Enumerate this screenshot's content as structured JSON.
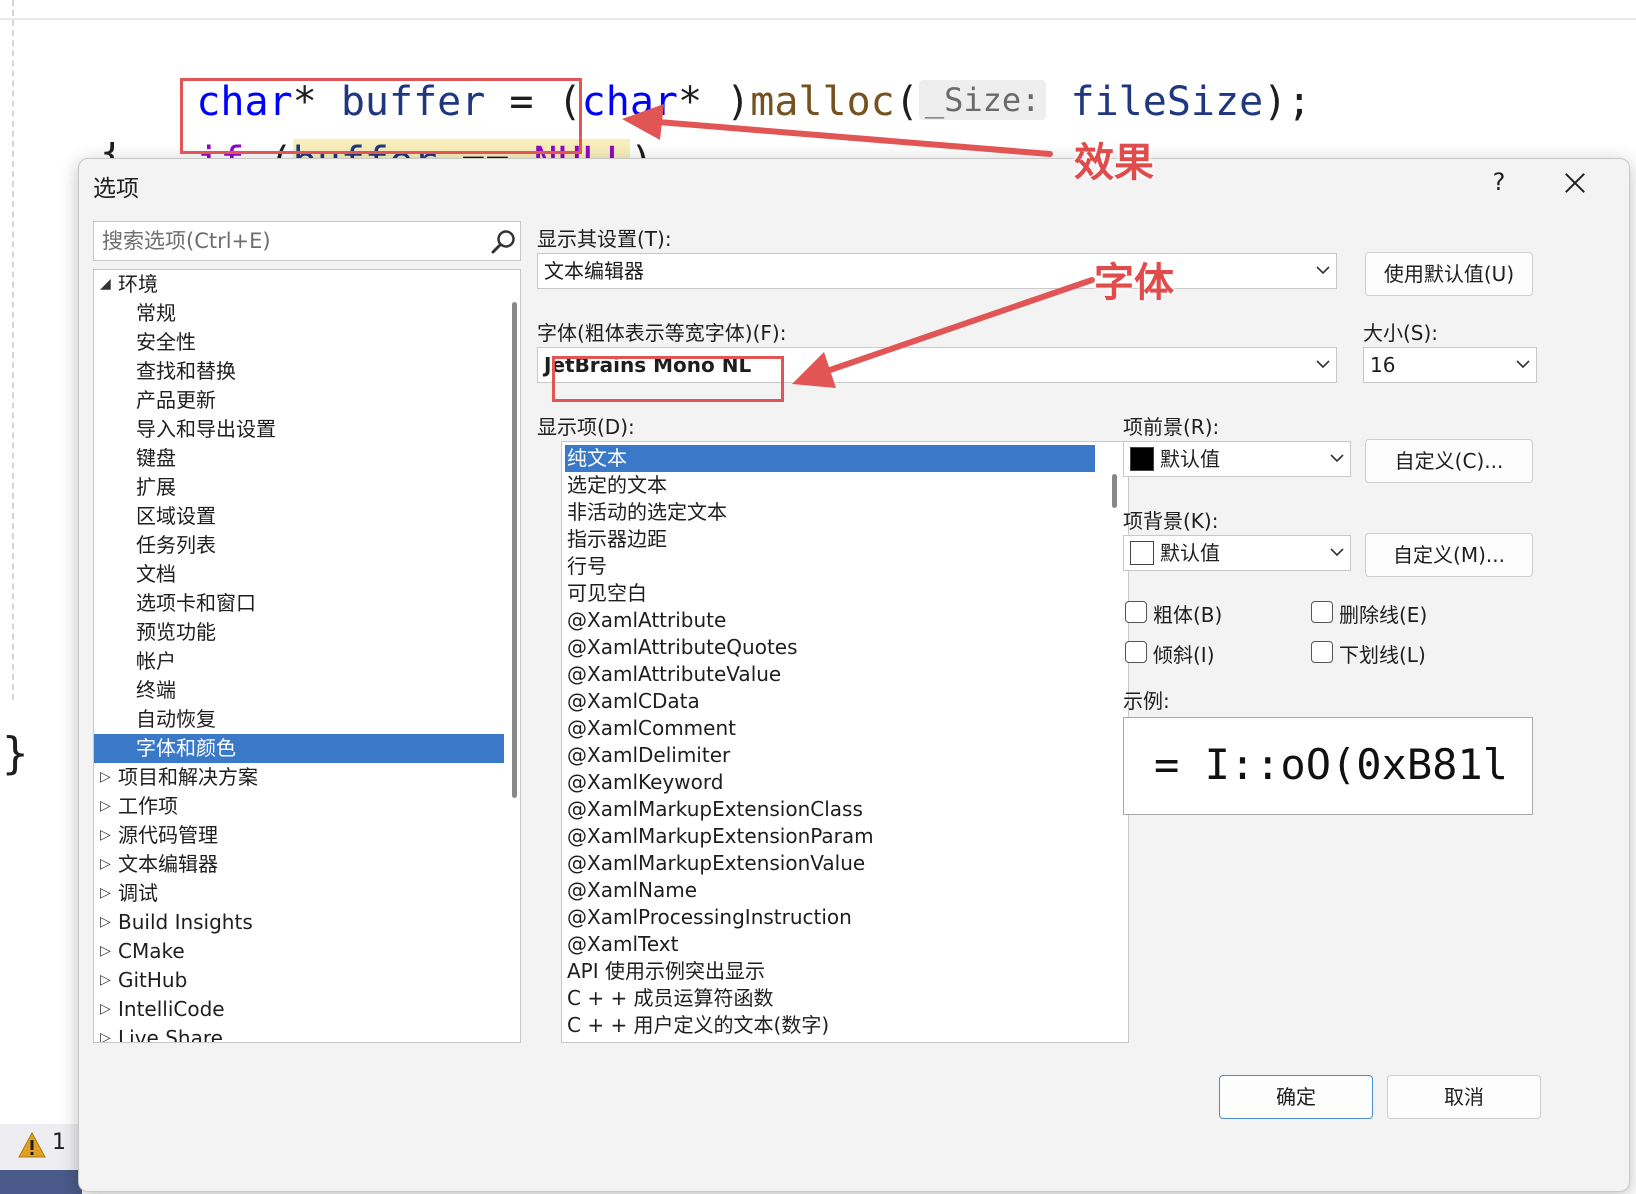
{
  "editor": {
    "line1": {
      "kw1": "char",
      "p1": "* ",
      "v1": "buffer",
      "p2": " = (",
      "kw2": "char",
      "p3": "* )",
      "fn": "malloc",
      "p4": "(",
      "hint": "_Size:",
      "v2": " fileSize",
      "p5": ");"
    },
    "line2": {
      "kw": "if",
      "p1": " (",
      "v1": "buffer",
      "p2": " == ",
      "kw2": "NULL",
      "p3": ")"
    },
    "brace_open": "{",
    "brace_close": "}",
    "warning_count": "1"
  },
  "annotations": {
    "effect": "效果",
    "font": "字体",
    "color": "#e25555"
  },
  "dialog": {
    "title": "选项",
    "help": "?",
    "search_placeholder": "搜索选项(Ctrl+E)",
    "tree": {
      "root": "环境",
      "children": [
        "常规",
        "安全性",
        "查找和替换",
        "产品更新",
        "导入和导出设置",
        "键盘",
        "扩展",
        "区域设置",
        "任务列表",
        "文档",
        "选项卡和窗口",
        "预览功能",
        "帐户",
        "终端",
        "自动恢复",
        "字体和颜色"
      ],
      "selected": "字体和颜色",
      "collapsed": [
        "项目和解决方案",
        "工作项",
        "源代码管理",
        "文本编辑器",
        "调试",
        "Build Insights",
        "CMake",
        "GitHub",
        "IntelliCode",
        "Live Share"
      ]
    },
    "show_settings_label": "显示其设置(T):",
    "show_settings_value": "文本编辑器",
    "use_defaults_button": "使用默认值(U)",
    "font_label": "字体(粗体表示等宽字体)(F):",
    "font_value": "JetBrains Mono NL",
    "size_label": "大小(S):",
    "size_value": "16",
    "display_items_label": "显示项(D):",
    "display_items": [
      "纯文本",
      "选定的文本",
      "非活动的选定文本",
      "指示器边距",
      "行号",
      "可见空白",
      "@XamlAttribute",
      "@XamlAttributeQuotes",
      "@XamlAttributeValue",
      "@XamlCData",
      "@XamlComment",
      "@XamlDelimiter",
      "@XamlKeyword",
      "@XamlMarkupExtensionClass",
      "@XamlMarkupExtensionParam",
      "@XamlMarkupExtensionValue",
      "@XamlName",
      "@XamlProcessingInstruction",
      "@XamlText",
      "API 使用示例突出显示",
      "C + + 成员运算符函数",
      "C + + 用户定义的文本(数字)"
    ],
    "display_selected": "纯文本",
    "fg_label": "项前景(R):",
    "fg_value": "默认值",
    "fg_custom_button": "自定义(C)...",
    "bg_label": "项背景(K):",
    "bg_value": "默认值",
    "bg_custom_button": "自定义(M)...",
    "checks": {
      "bold": "粗体(B)",
      "strike": "删除线(E)",
      "italic": "倾斜(I)",
      "underline": "下划线(L)"
    },
    "sample_label": "示例:",
    "sample_text": "= I::oO(0xB81l",
    "ok_button": "确定",
    "cancel_button": "取消"
  }
}
